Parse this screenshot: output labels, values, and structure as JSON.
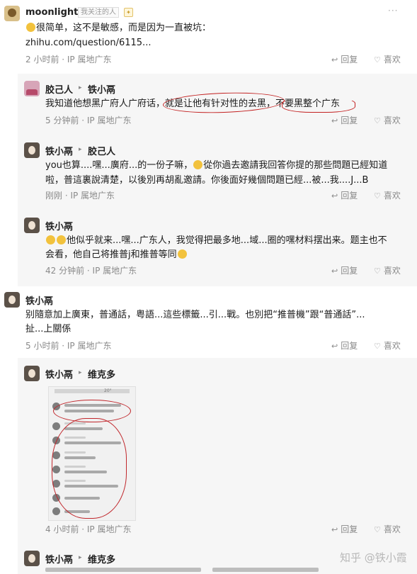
{
  "comments": {
    "c1": {
      "author": "moonlight",
      "tag": "我关注的人",
      "text1": "很简单，这不是敏感，而是因为一直被坑：",
      "text2": "zhihu.com/question/6115...",
      "meta": "2 小时前 · IP 属地广东",
      "reply": "回复",
      "like": "喜欢"
    },
    "c2": {
      "author": "胶己人",
      "target": "铁小鬲",
      "text": "我知道他想黑广府人广府话，就是让他有针对性的去黑，不要黑整个广东",
      "meta": "5 分钟前 · IP 属地广东",
      "reply": "回复",
      "like": "喜欢"
    },
    "c3": {
      "author": "铁小鬲",
      "target": "胶己人",
      "text1": "you也算....嘿...廣府...的一份子嘛，",
      "text1b": "從你過去邀請我回答你提的那些問題已經知道",
      "text2": "啦，普這裏說清楚，以後別再胡亂邀請。你後面好幾個問題已經...被...我....J...B",
      "meta": "刚刚 · IP 属地广东",
      "reply": "回复",
      "like": "喜欢"
    },
    "c4": {
      "author": "铁小鬲",
      "text1": "他似乎就来...嘿...广东人，我觉得把最多地...域...圈的嘿材料摆出来。题主也不",
      "text2": "会看，他自己将推普j和推普等同",
      "meta": "42 分钟前 · IP 属地广东",
      "reply": "回复",
      "like": "喜欢"
    },
    "c5": {
      "author": "铁小鬲",
      "text1": "别隨意加上廣東，普通話，粤語...這些標籤...引...戰。也別把“推普機”跟“普通話”...",
      "text2": "扯...上關係",
      "meta": "5 小时前 · IP 属地广东",
      "reply": "回复",
      "like": "喜欢"
    },
    "c6": {
      "author": "铁小鬲",
      "target": "维克多",
      "thumb_time": "20°",
      "meta": "4 小时前 · IP 属地广东",
      "reply": "回复",
      "like": "喜欢"
    },
    "c7": {
      "author": "铁小鬲",
      "target": "维克多"
    }
  },
  "watermark": "知乎 @铁小霞",
  "icons": {
    "reply": "reply-icon",
    "like": "heart-icon",
    "verified": "badge-icon"
  },
  "colors": {
    "annotation_red": "#c21f1f",
    "meta_gray": "#8a8a8a",
    "sub_bg": "#f6f6f6"
  }
}
